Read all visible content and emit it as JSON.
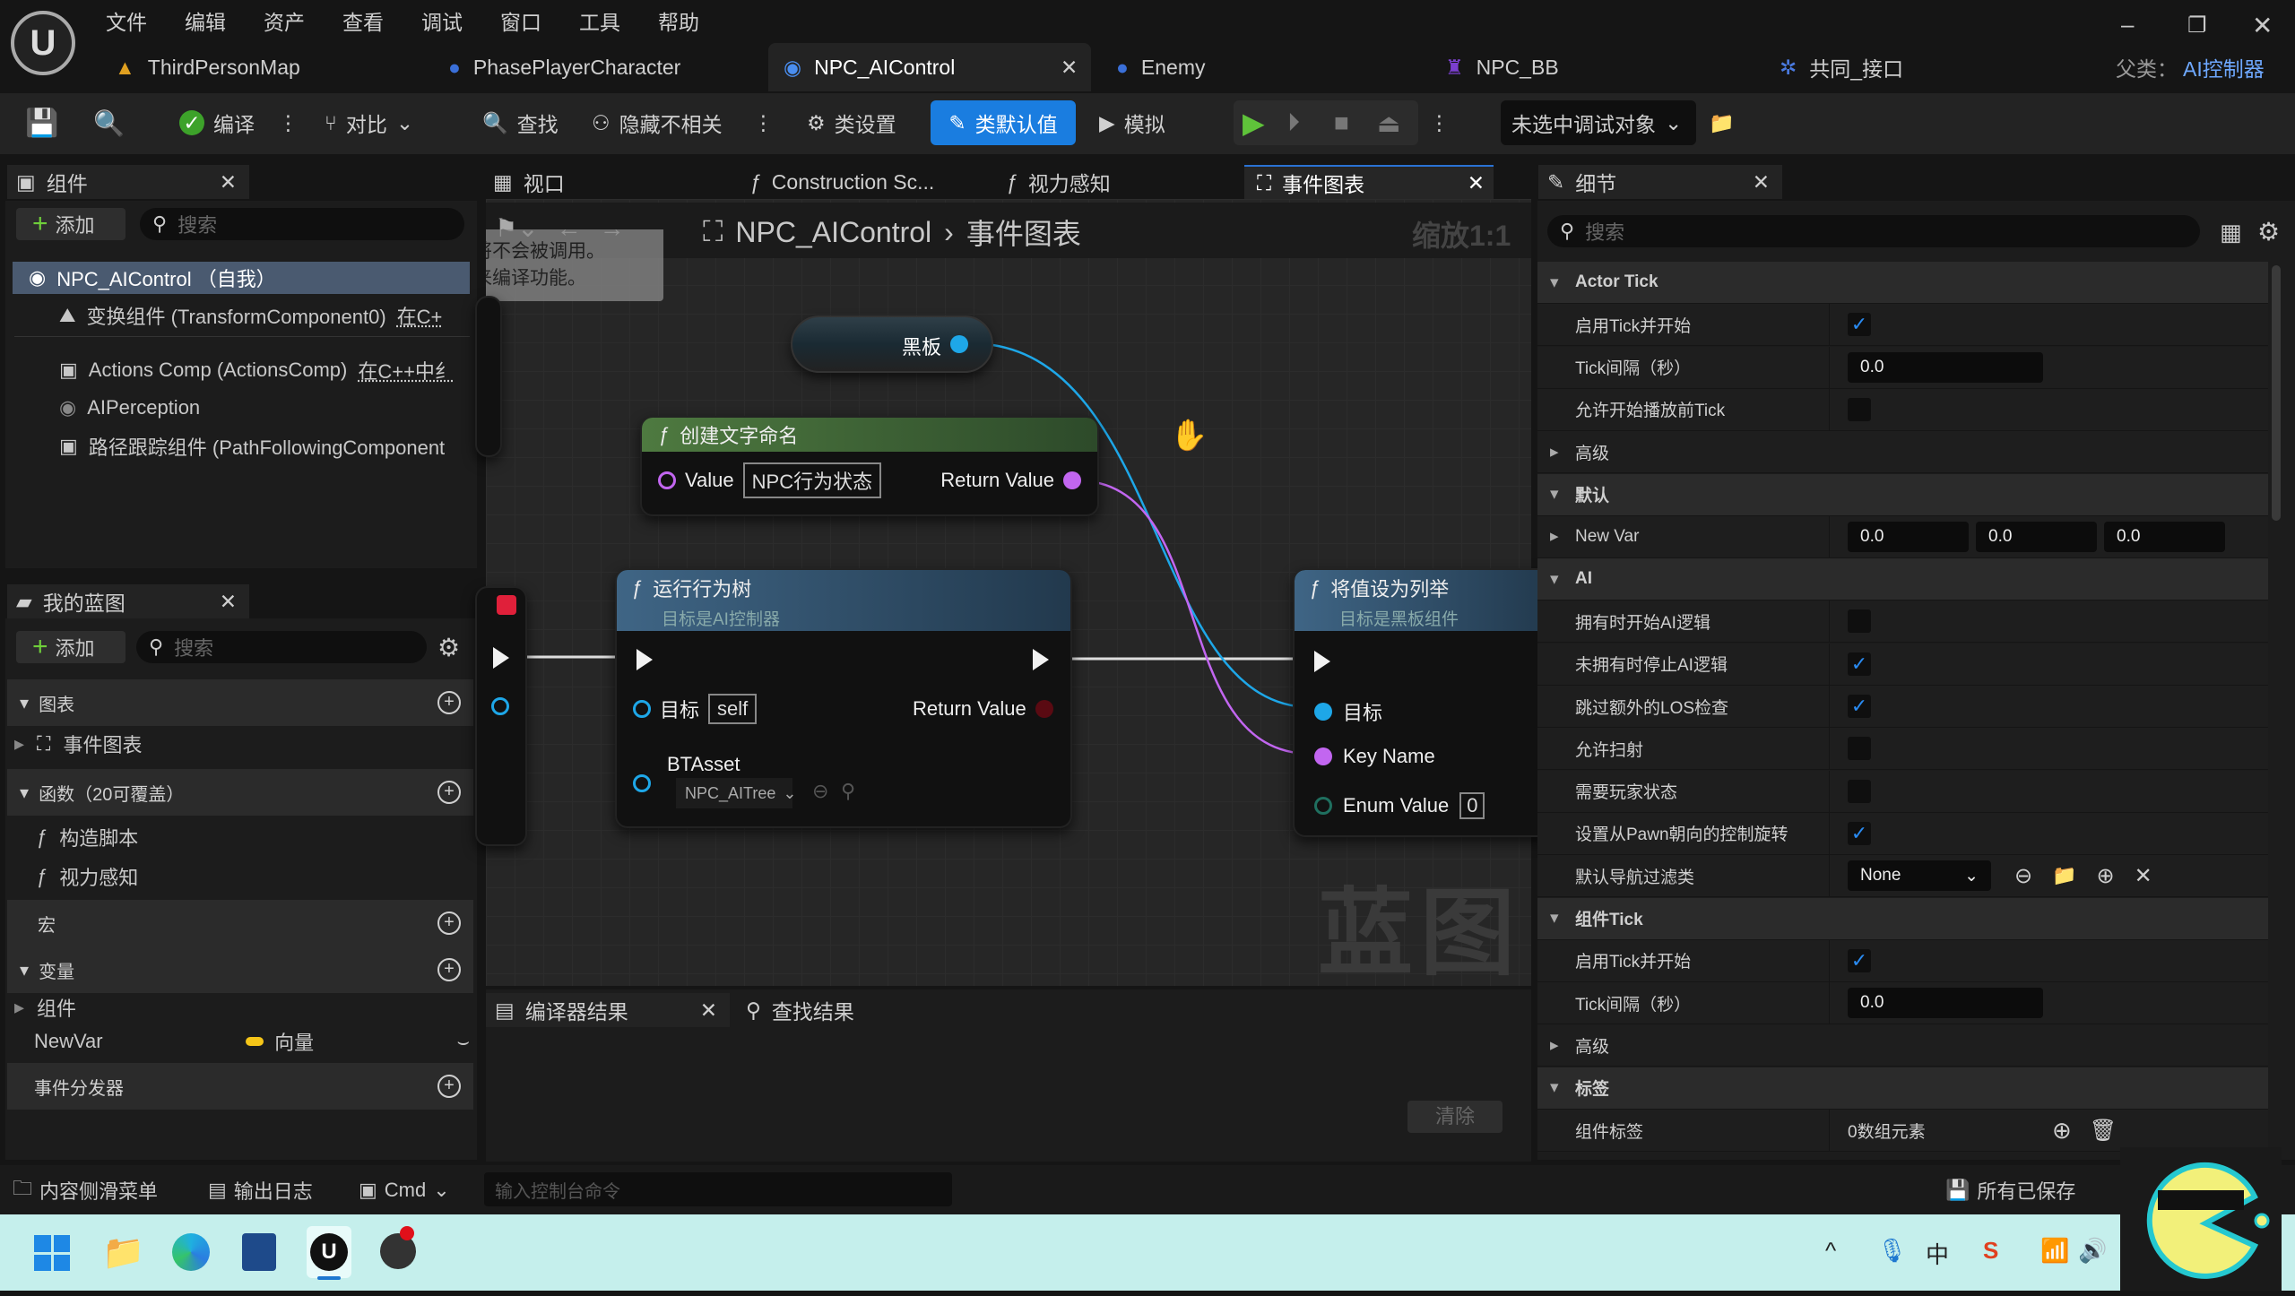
{
  "menu": [
    "文件",
    "编辑",
    "资产",
    "查看",
    "调试",
    "窗口",
    "工具",
    "帮助"
  ],
  "doc_tabs": [
    {
      "label": "ThirdPersonMap",
      "icon": "map-icon"
    },
    {
      "label": "PhasePlayerCharacter",
      "icon": "character-blueprint-icon"
    },
    {
      "label": "NPC_AIControl",
      "icon": "ai-controller-icon",
      "active": true
    },
    {
      "label": "Enemy",
      "icon": "character-blueprint-icon"
    },
    {
      "label": "NPC_BB",
      "icon": "blackboard-icon"
    },
    {
      "label": "共同_接口",
      "icon": "interface-icon"
    }
  ],
  "parent_class": {
    "label": "父类：",
    "value": "AI控制器"
  },
  "toolbar": {
    "compile": "编译",
    "diff": "对比",
    "find": "查找",
    "hide_unrelated": "隐藏不相关",
    "class_settings": "类设置",
    "class_defaults": "类默认值",
    "simulate": "模拟",
    "debug_target": "未选中调试对象"
  },
  "components_panel": {
    "title": "组件",
    "add": "添加",
    "search_placeholder": "搜索",
    "root": "NPC_AIControl （自我）",
    "items": [
      {
        "label": "变换组件 (TransformComponent0)",
        "note": "在C+"
      },
      {
        "label": "Actions Comp (ActionsComp)",
        "note": "在C++中纟"
      },
      {
        "label": "AIPerception",
        "note": ""
      },
      {
        "label": "路径跟踪组件 (PathFollowingComponent",
        "note": ""
      }
    ]
  },
  "my_blueprint": {
    "title": "我的蓝图",
    "add": "添加",
    "search_placeholder": "搜索",
    "graphs": "图表",
    "event_graph": "事件图表",
    "functions": "函数（20可覆盖）",
    "construction_script": "构造脚本",
    "vision": "视力感知",
    "macros": "宏",
    "variables": "变量",
    "components": "组件",
    "var_name": "NewVar",
    "var_type": "向量",
    "dispatchers": "事件分发器",
    "vector_color": "#f5c518"
  },
  "graph_tabs": [
    "视口",
    "Construction Sc...",
    "视力感知",
    "事件图表"
  ],
  "graph": {
    "breadcrumb_root": "NPC_AIControl",
    "breadcrumb_leaf": "事件图表",
    "zoom": "缩放1:1",
    "toast": [
      "将不会被调用。",
      "来编译功能。"
    ],
    "watermark": "蓝图",
    "blackboard_node": "黑板",
    "make_name": {
      "title": "创建文字命名",
      "value_label": "Value",
      "value": "NPC行为状态",
      "return": "Return Value"
    },
    "run_bt": {
      "title": "运行行为树",
      "subtitle": "目标是AI控制器",
      "target": "目标",
      "target_value": "self",
      "return": "Return Value",
      "asset_label": "BTAsset",
      "asset": "NPC_AITree"
    },
    "set_enum": {
      "title": "将值设为列举",
      "subtitle": "目标是黑板组件",
      "target": "目标",
      "key": "Key Name",
      "enum": "Enum Value",
      "enum_value": "0"
    },
    "colors": {
      "object_pin": "#1ea7e8",
      "name_pin": "#c266f0",
      "exec": "#f2f2f2"
    }
  },
  "results": {
    "compiler_tab": "编译器结果",
    "find_tab": "查找结果",
    "clear": "清除"
  },
  "details": {
    "title": "细节",
    "search_placeholder": "搜索",
    "rows": [
      {
        "type": "section",
        "label": "Actor Tick"
      },
      {
        "type": "check",
        "label": "启用Tick并开始",
        "value": true
      },
      {
        "type": "number",
        "label": "Tick间隔（秒）",
        "value": "0.0"
      },
      {
        "type": "check",
        "label": "允许开始播放前Tick",
        "value": false
      },
      {
        "type": "collapsed",
        "label": "高级"
      },
      {
        "type": "section",
        "label": "默认"
      },
      {
        "type": "vector",
        "label": "New Var",
        "value": [
          "0.0",
          "0.0",
          "0.0"
        ]
      },
      {
        "type": "section",
        "label": "AI"
      },
      {
        "type": "check",
        "label": "拥有时开始AI逻辑",
        "value": false
      },
      {
        "type": "check",
        "label": "未拥有时停止AI逻辑",
        "value": true
      },
      {
        "type": "check",
        "label": "跳过额外的LOS检查",
        "value": true
      },
      {
        "type": "check",
        "label": "允许扫射",
        "value": false
      },
      {
        "type": "check",
        "label": "需要玩家状态",
        "value": false
      },
      {
        "type": "check",
        "label": "设置从Pawn朝向的控制旋转",
        "value": true
      },
      {
        "type": "dropdown",
        "label": "默认导航过滤类",
        "value": "None"
      },
      {
        "type": "section",
        "label": "组件Tick"
      },
      {
        "type": "check",
        "label": "启用Tick并开始",
        "value": true
      },
      {
        "type": "number",
        "label": "Tick间隔（秒）",
        "value": "0.0"
      },
      {
        "type": "collapsed",
        "label": "高级"
      },
      {
        "type": "section",
        "label": "标签"
      },
      {
        "type": "array",
        "label": "组件标签",
        "value": "0数组元素"
      }
    ]
  },
  "status_bar": {
    "content_drawer": "内容侧滑菜单",
    "output_log": "输出日志",
    "cmd": "Cmd",
    "console_placeholder": "输入控制台命令",
    "saved": "所有已保存"
  },
  "taskbar": {
    "apps": [
      "start-icon",
      "file-explorer-icon",
      "edge-icon",
      "store-icon",
      "unreal-engine-icon",
      "obs-icon"
    ],
    "tray_ime": "中"
  }
}
